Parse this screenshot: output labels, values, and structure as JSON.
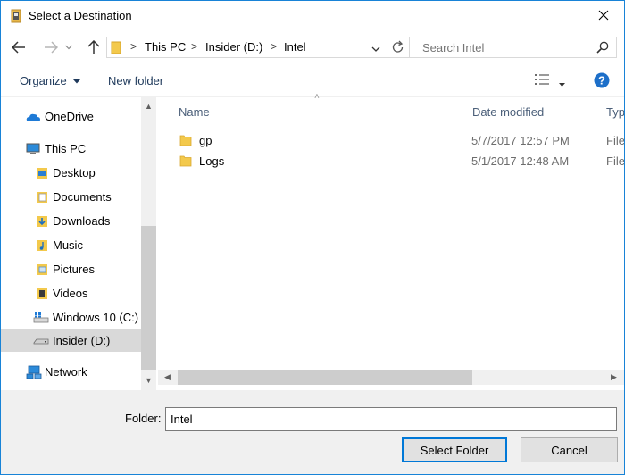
{
  "window": {
    "title": "Select a Destination",
    "accent": "#1883d7"
  },
  "address": {
    "crumbs": [
      "This PC",
      "Insider (D:)",
      "Intel"
    ],
    "search_placeholder": "Search Intel"
  },
  "toolbar": {
    "organize_label": "Organize",
    "new_folder_label": "New folder",
    "help_icon": "help-icon"
  },
  "nav": {
    "items": [
      {
        "label": "OneDrive",
        "icon": "onedrive-icon"
      },
      {
        "label": "This PC",
        "icon": "computer-icon"
      },
      {
        "label": "Desktop",
        "icon": "desktop-folder-icon"
      },
      {
        "label": "Documents",
        "icon": "documents-folder-icon"
      },
      {
        "label": "Downloads",
        "icon": "downloads-folder-icon"
      },
      {
        "label": "Music",
        "icon": "music-folder-icon"
      },
      {
        "label": "Pictures",
        "icon": "pictures-folder-icon"
      },
      {
        "label": "Videos",
        "icon": "videos-folder-icon"
      },
      {
        "label": "Windows 10 (C:)",
        "icon": "system-drive-icon"
      },
      {
        "label": "Insider (D:)",
        "icon": "drive-icon",
        "selected": true
      },
      {
        "label": "Network",
        "icon": "network-icon"
      }
    ]
  },
  "files": {
    "columns": [
      "Name",
      "Date modified",
      "Typ"
    ],
    "rows": [
      {
        "name": "gp",
        "date": "5/7/2017 12:57 PM",
        "type": "File"
      },
      {
        "name": "Logs",
        "date": "5/1/2017 12:48 AM",
        "type": "File"
      }
    ]
  },
  "footer": {
    "folder_label": "Folder:",
    "folder_value": "Intel",
    "select_label": "Select Folder",
    "cancel_label": "Cancel"
  }
}
